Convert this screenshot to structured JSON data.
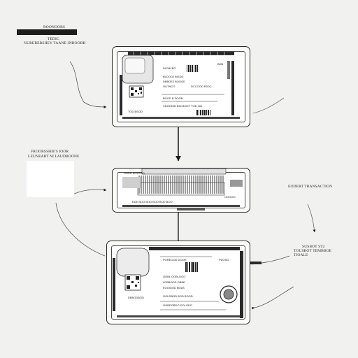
{
  "labels": {
    "top_left_1": "ROONOOBS",
    "top_left_2": "TEDIC",
    "top_left_3": "NUREBERSHEY TAANE JNBOOBR",
    "mid_left_1": "FROOBSSHIE'S IOOR",
    "mid_left_2": "LEUNEART NI LAUDBOONE",
    "mid_right_1": "EODERT TRANSACTION",
    "bottom_right_1": "SUSBOT ST2",
    "bottom_right_2": "TOUSBOT TEMBBOE",
    "bottom_right_3": "TIOALE"
  },
  "card_top": {
    "field_1": "BDB",
    "field_2": "DO34LBO",
    "field_3": "BLOODJ BISDD",
    "field_4": "DBBOEJ BOOOD",
    "field_5": "OUTNCO",
    "field_6": "DCCOOD ED0C",
    "field_7": "BOOD B DOOB",
    "field_8": "CDOODID BID BOOT TOD 400",
    "field_9": "TOD BSOD"
  },
  "card_mid": {
    "field_1": "ODDD BODSSD",
    "field_2": "EDE BOO BOD BOD BOD BOO",
    "field_3": "OOOOO"
  },
  "card_bottom": {
    "field_1": "POREOOD DOOR",
    "field_2": "PDOSD",
    "field_3": "OOBL OOBLDOO",
    "field_4": "LDBBOOD OBBD",
    "field_5": "EOOIDOD BOLB",
    "field_6": "DBBODBOD",
    "field_7": "OOLDBOD BOD BOOD",
    "field_8": "OOBDOBDO DOLODO"
  },
  "colors": {
    "background": "#f1f1f0",
    "ink": "#1d1d1d"
  }
}
